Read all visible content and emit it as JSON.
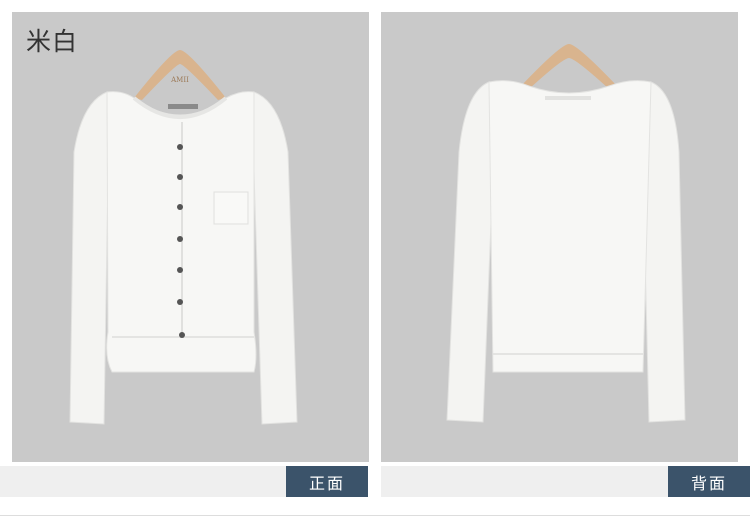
{
  "color_label": "米白",
  "hanger_brand": "AMII",
  "views": [
    {
      "caption": "正面"
    },
    {
      "caption": "背面"
    }
  ],
  "colors": {
    "panel_background": "#c9c9c9",
    "caption_tag": "#3b536a",
    "caption_bar": "#efefef",
    "garment": "#f7f7f5",
    "hanger": "#d9b48e"
  }
}
